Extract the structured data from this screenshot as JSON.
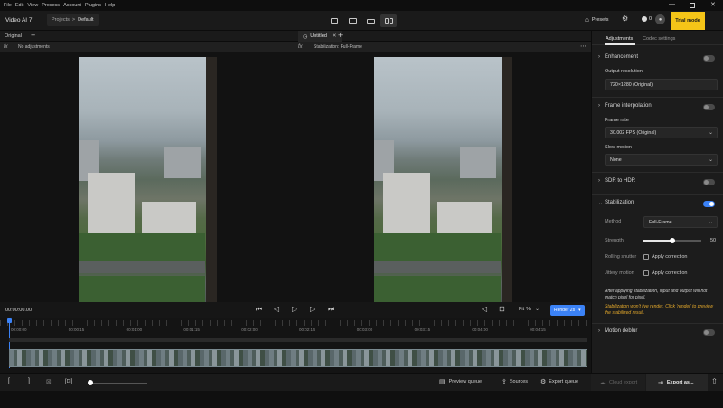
{
  "menu": [
    "File",
    "Edit",
    "View",
    "Process",
    "Account",
    "Plugins",
    "Help"
  ],
  "app_title": "Video AI 7",
  "breadcrumb": {
    "parent": "Projects",
    "separator": ">",
    "current": "Default"
  },
  "header": {
    "presets_label": "Presets",
    "credits": "0",
    "trial_label": "Trial mode"
  },
  "left_panel": {
    "tab_label": "Original",
    "sub_label": "No adjustments"
  },
  "right_panel": {
    "tab_label": "Untitled",
    "sub_label": "Stabilization: Full-Frame"
  },
  "settings": {
    "tabs": [
      "Adjustments",
      "Codec settings"
    ],
    "enhancement": {
      "title": "Enhancement",
      "enabled": false
    },
    "output_resolution": {
      "label": "Output resolution",
      "value": "720×1280 (Original)"
    },
    "frame_interpolation": {
      "title": "Frame interpolation",
      "enabled": false
    },
    "frame_rate": {
      "label": "Frame rate",
      "value": "30.002 FPS (Original)"
    },
    "slow_motion": {
      "label": "Slow motion",
      "value": "None"
    },
    "sdr_to_hdr": {
      "title": "SDR to HDR",
      "enabled": false
    },
    "stabilization": {
      "title": "Stabilization",
      "enabled": true,
      "method_label": "Method",
      "method_value": "Full-Frame",
      "strength_label": "Strength",
      "strength_value": "50",
      "rolling_label": "Rolling shutter",
      "rolling_option": "Apply correction",
      "jittery_label": "Jittery motion",
      "jittery_option": "Apply correction",
      "note": "After applying stabilization, input and output will not match pixel for pixel.",
      "warning": "Stabilization won't live render. Click 'render' to preview the stabilized result."
    },
    "motion_deblur": {
      "title": "Motion deblur",
      "enabled": false
    }
  },
  "transport": {
    "timecode": "00:00:00.00",
    "fit_label": "Fit",
    "fit_suffix": "%",
    "render_label": "Render 2s"
  },
  "timeline": {
    "ticks": [
      "00:00:00",
      "00:00:15",
      "00:01:00",
      "00:01:15",
      "00:02:00",
      "00:02:15",
      "00:03:00",
      "00:03:15",
      "00:04:00",
      "00:04:15"
    ]
  },
  "bottom": {
    "preview_queue": "Preview queue",
    "sources": "Sources",
    "export_queue": "Export queue",
    "cloud_export": "Cloud export",
    "export_as": "Export as..."
  },
  "colors": {
    "accent": "#3b82f6",
    "trial": "#f5c518",
    "warning": "#e3a82b"
  }
}
